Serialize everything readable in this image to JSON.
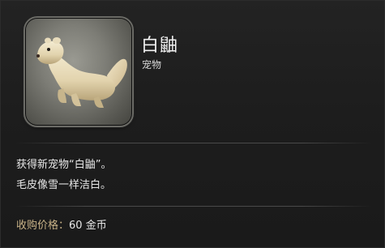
{
  "item": {
    "name": "白鼬",
    "category": "宠物",
    "icon": "ferret-icon"
  },
  "description": {
    "line1": "获得新宠物“白鼬”。",
    "line2": "毛皮像雪一样洁白。"
  },
  "price": {
    "label": "收购价格：",
    "value": "60 金币"
  },
  "colors": {
    "price_label": "#c8b287",
    "text": "#e6e6e6",
    "background": "#1b1b1b"
  }
}
